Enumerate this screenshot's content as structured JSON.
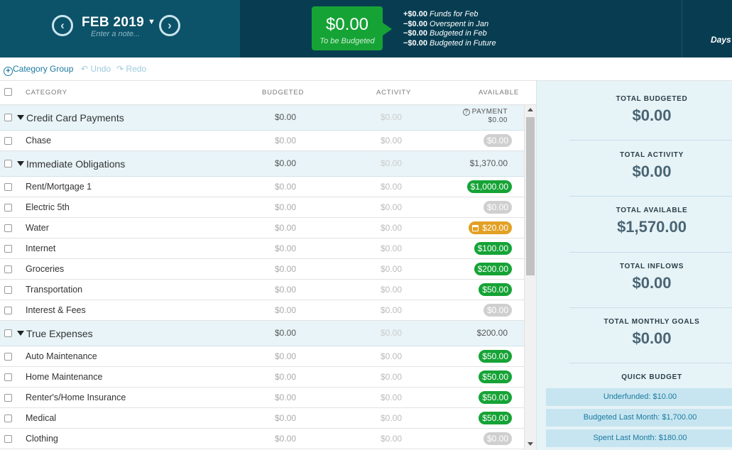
{
  "header": {
    "month": "FEB 2019",
    "note_placeholder": "Enter a note...",
    "to_be_budgeted_amount": "$0.00",
    "to_be_budgeted_label": "To be Budgeted",
    "summary": [
      {
        "amount": "+$0.00",
        "label": "Funds for Feb"
      },
      {
        "amount": "−$0.00",
        "label": "Overspent in Jan"
      },
      {
        "amount": "−$0.00",
        "label": "Budgeted in Feb"
      },
      {
        "amount": "−$0.00",
        "label": "Budgeted in Future"
      }
    ],
    "days_label": "Days o"
  },
  "toolbar": {
    "category_group": "Category Group",
    "undo": "Undo",
    "redo": "Redo"
  },
  "columns": {
    "category": "CATEGORY",
    "budgeted": "BUDGETED",
    "activity": "ACTIVITY",
    "available": "AVAILABLE"
  },
  "rows": [
    {
      "type": "group",
      "name": "Credit Card Payments",
      "budgeted": "$0.00",
      "activity": "$0.00",
      "payment_label": "PAYMENT",
      "payment_amount": "$0.00"
    },
    {
      "type": "item",
      "name": "Chase",
      "budgeted": "$0.00",
      "activity": "$0.00",
      "available": "$0.00",
      "status": "gray"
    },
    {
      "type": "group",
      "name": "Immediate Obligations",
      "budgeted": "$0.00",
      "activity": "$0.00",
      "available": "$1,370.00"
    },
    {
      "type": "item",
      "name": "Rent/Mortgage 1",
      "budgeted": "$0.00",
      "activity": "$0.00",
      "available": "$1,000.00",
      "status": "green"
    },
    {
      "type": "item",
      "name": "Electric 5th",
      "budgeted": "$0.00",
      "activity": "$0.00",
      "available": "$0.00",
      "status": "gray"
    },
    {
      "type": "item",
      "name": "Water",
      "budgeted": "$0.00",
      "activity": "$0.00",
      "available": "$20.00",
      "status": "orange",
      "icon": "calendar-icon"
    },
    {
      "type": "item",
      "name": "Internet",
      "budgeted": "$0.00",
      "activity": "$0.00",
      "available": "$100.00",
      "status": "green"
    },
    {
      "type": "item",
      "name": "Groceries",
      "budgeted": "$0.00",
      "activity": "$0.00",
      "available": "$200.00",
      "status": "green"
    },
    {
      "type": "item",
      "name": "Transportation",
      "budgeted": "$0.00",
      "activity": "$0.00",
      "available": "$50.00",
      "status": "green"
    },
    {
      "type": "item",
      "name": "Interest & Fees",
      "budgeted": "$0.00",
      "activity": "$0.00",
      "available": "$0.00",
      "status": "gray"
    },
    {
      "type": "group",
      "name": "True Expenses",
      "budgeted": "$0.00",
      "activity": "$0.00",
      "available": "$200.00"
    },
    {
      "type": "item",
      "name": "Auto Maintenance",
      "budgeted": "$0.00",
      "activity": "$0.00",
      "available": "$50.00",
      "status": "green"
    },
    {
      "type": "item",
      "name": "Home Maintenance",
      "budgeted": "$0.00",
      "activity": "$0.00",
      "available": "$50.00",
      "status": "green"
    },
    {
      "type": "item",
      "name": "Renter's/Home Insurance",
      "budgeted": "$0.00",
      "activity": "$0.00",
      "available": "$50.00",
      "status": "green"
    },
    {
      "type": "item",
      "name": "Medical",
      "budgeted": "$0.00",
      "activity": "$0.00",
      "available": "$50.00",
      "status": "green"
    },
    {
      "type": "item",
      "name": "Clothing",
      "budgeted": "$0.00",
      "activity": "$0.00",
      "available": "$0.00",
      "status": "gray"
    }
  ],
  "inspector": {
    "total_budgeted_label": "TOTAL BUDGETED",
    "total_budgeted": "$0.00",
    "total_activity_label": "TOTAL ACTIVITY",
    "total_activity": "$0.00",
    "total_available_label": "TOTAL AVAILABLE",
    "total_available": "$1,570.00",
    "total_inflows_label": "TOTAL INFLOWS",
    "total_inflows": "$0.00",
    "total_goals_label": "TOTAL MONTHLY GOALS",
    "total_goals": "$0.00",
    "quick_budget_label": "QUICK BUDGET",
    "quick_budget": [
      "Underfunded: $10.00",
      "Budgeted Last Month: $1,700.00",
      "Spent Last Month: $180.00"
    ]
  },
  "colors": {
    "header_bg": "#083d51",
    "month_bg": "#0c5269",
    "accent_green": "#16a336",
    "pill_gray": "#cfcfcf",
    "pill_orange": "#e2a024",
    "group_row_bg": "#e8f4f8",
    "inspector_bg": "#e6f3f7",
    "link_blue": "#1a7aa0"
  }
}
